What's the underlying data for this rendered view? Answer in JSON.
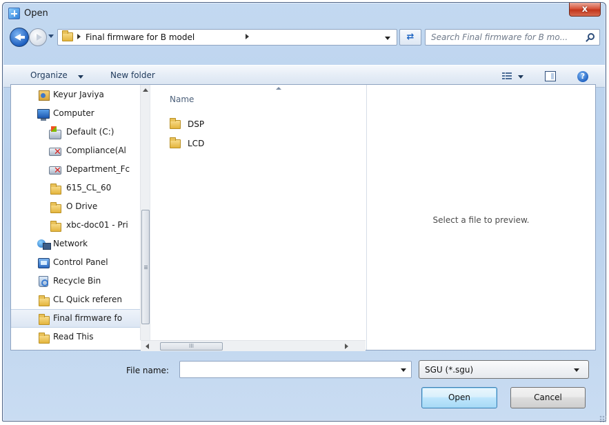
{
  "window": {
    "title": "Open",
    "close_label": "x"
  },
  "address": {
    "path_label": "Final firmware for B model"
  },
  "search": {
    "placeholder": "Search Final firmware for B mo..."
  },
  "toolbar": {
    "organize_label": "Organize",
    "new_folder_label": "New folder"
  },
  "nav": {
    "items": [
      {
        "label": "Keyur Javiya",
        "icon": "user-folder-icon"
      },
      {
        "label": "Computer",
        "icon": "computer-icon"
      },
      {
        "label": "Default (C:)",
        "icon": "local-drive-icon"
      },
      {
        "label": "Compliance(Al",
        "icon": "disconnected-network-drive-icon"
      },
      {
        "label": "Department_Fc",
        "icon": "disconnected-network-drive-icon"
      },
      {
        "label": "615_CL_60",
        "icon": "folder-icon"
      },
      {
        "label": "O Drive",
        "icon": "folder-icon"
      },
      {
        "label": "xbc-doc01 - Pri",
        "icon": "folder-icon"
      },
      {
        "label": "Network",
        "icon": "network-icon"
      },
      {
        "label": "Control Panel",
        "icon": "control-panel-icon"
      },
      {
        "label": "Recycle Bin",
        "icon": "recycle-bin-icon"
      },
      {
        "label": "CL Quick referen",
        "icon": "folder-icon"
      },
      {
        "label": "Final firmware fo",
        "icon": "folder-icon",
        "selected": true
      },
      {
        "label": "Read This",
        "icon": "folder-icon"
      }
    ]
  },
  "files": {
    "column_name": "Name",
    "items": [
      {
        "label": "DSP",
        "icon": "folder-icon"
      },
      {
        "label": "LCD",
        "icon": "folder-icon"
      }
    ],
    "hscroll_grip": "III"
  },
  "preview": {
    "message": "Select a file to preview."
  },
  "bottom": {
    "file_name_label": "File name:",
    "file_name_value": "",
    "file_type_selected": "SGU (*.sgu)",
    "open_label": "Open",
    "cancel_label": "Cancel"
  },
  "colors": {
    "chrome": "#c3d9f1",
    "close_button": "#c2351c",
    "default_button": "#bee6fd",
    "selected_nav": "#dce6f3"
  }
}
